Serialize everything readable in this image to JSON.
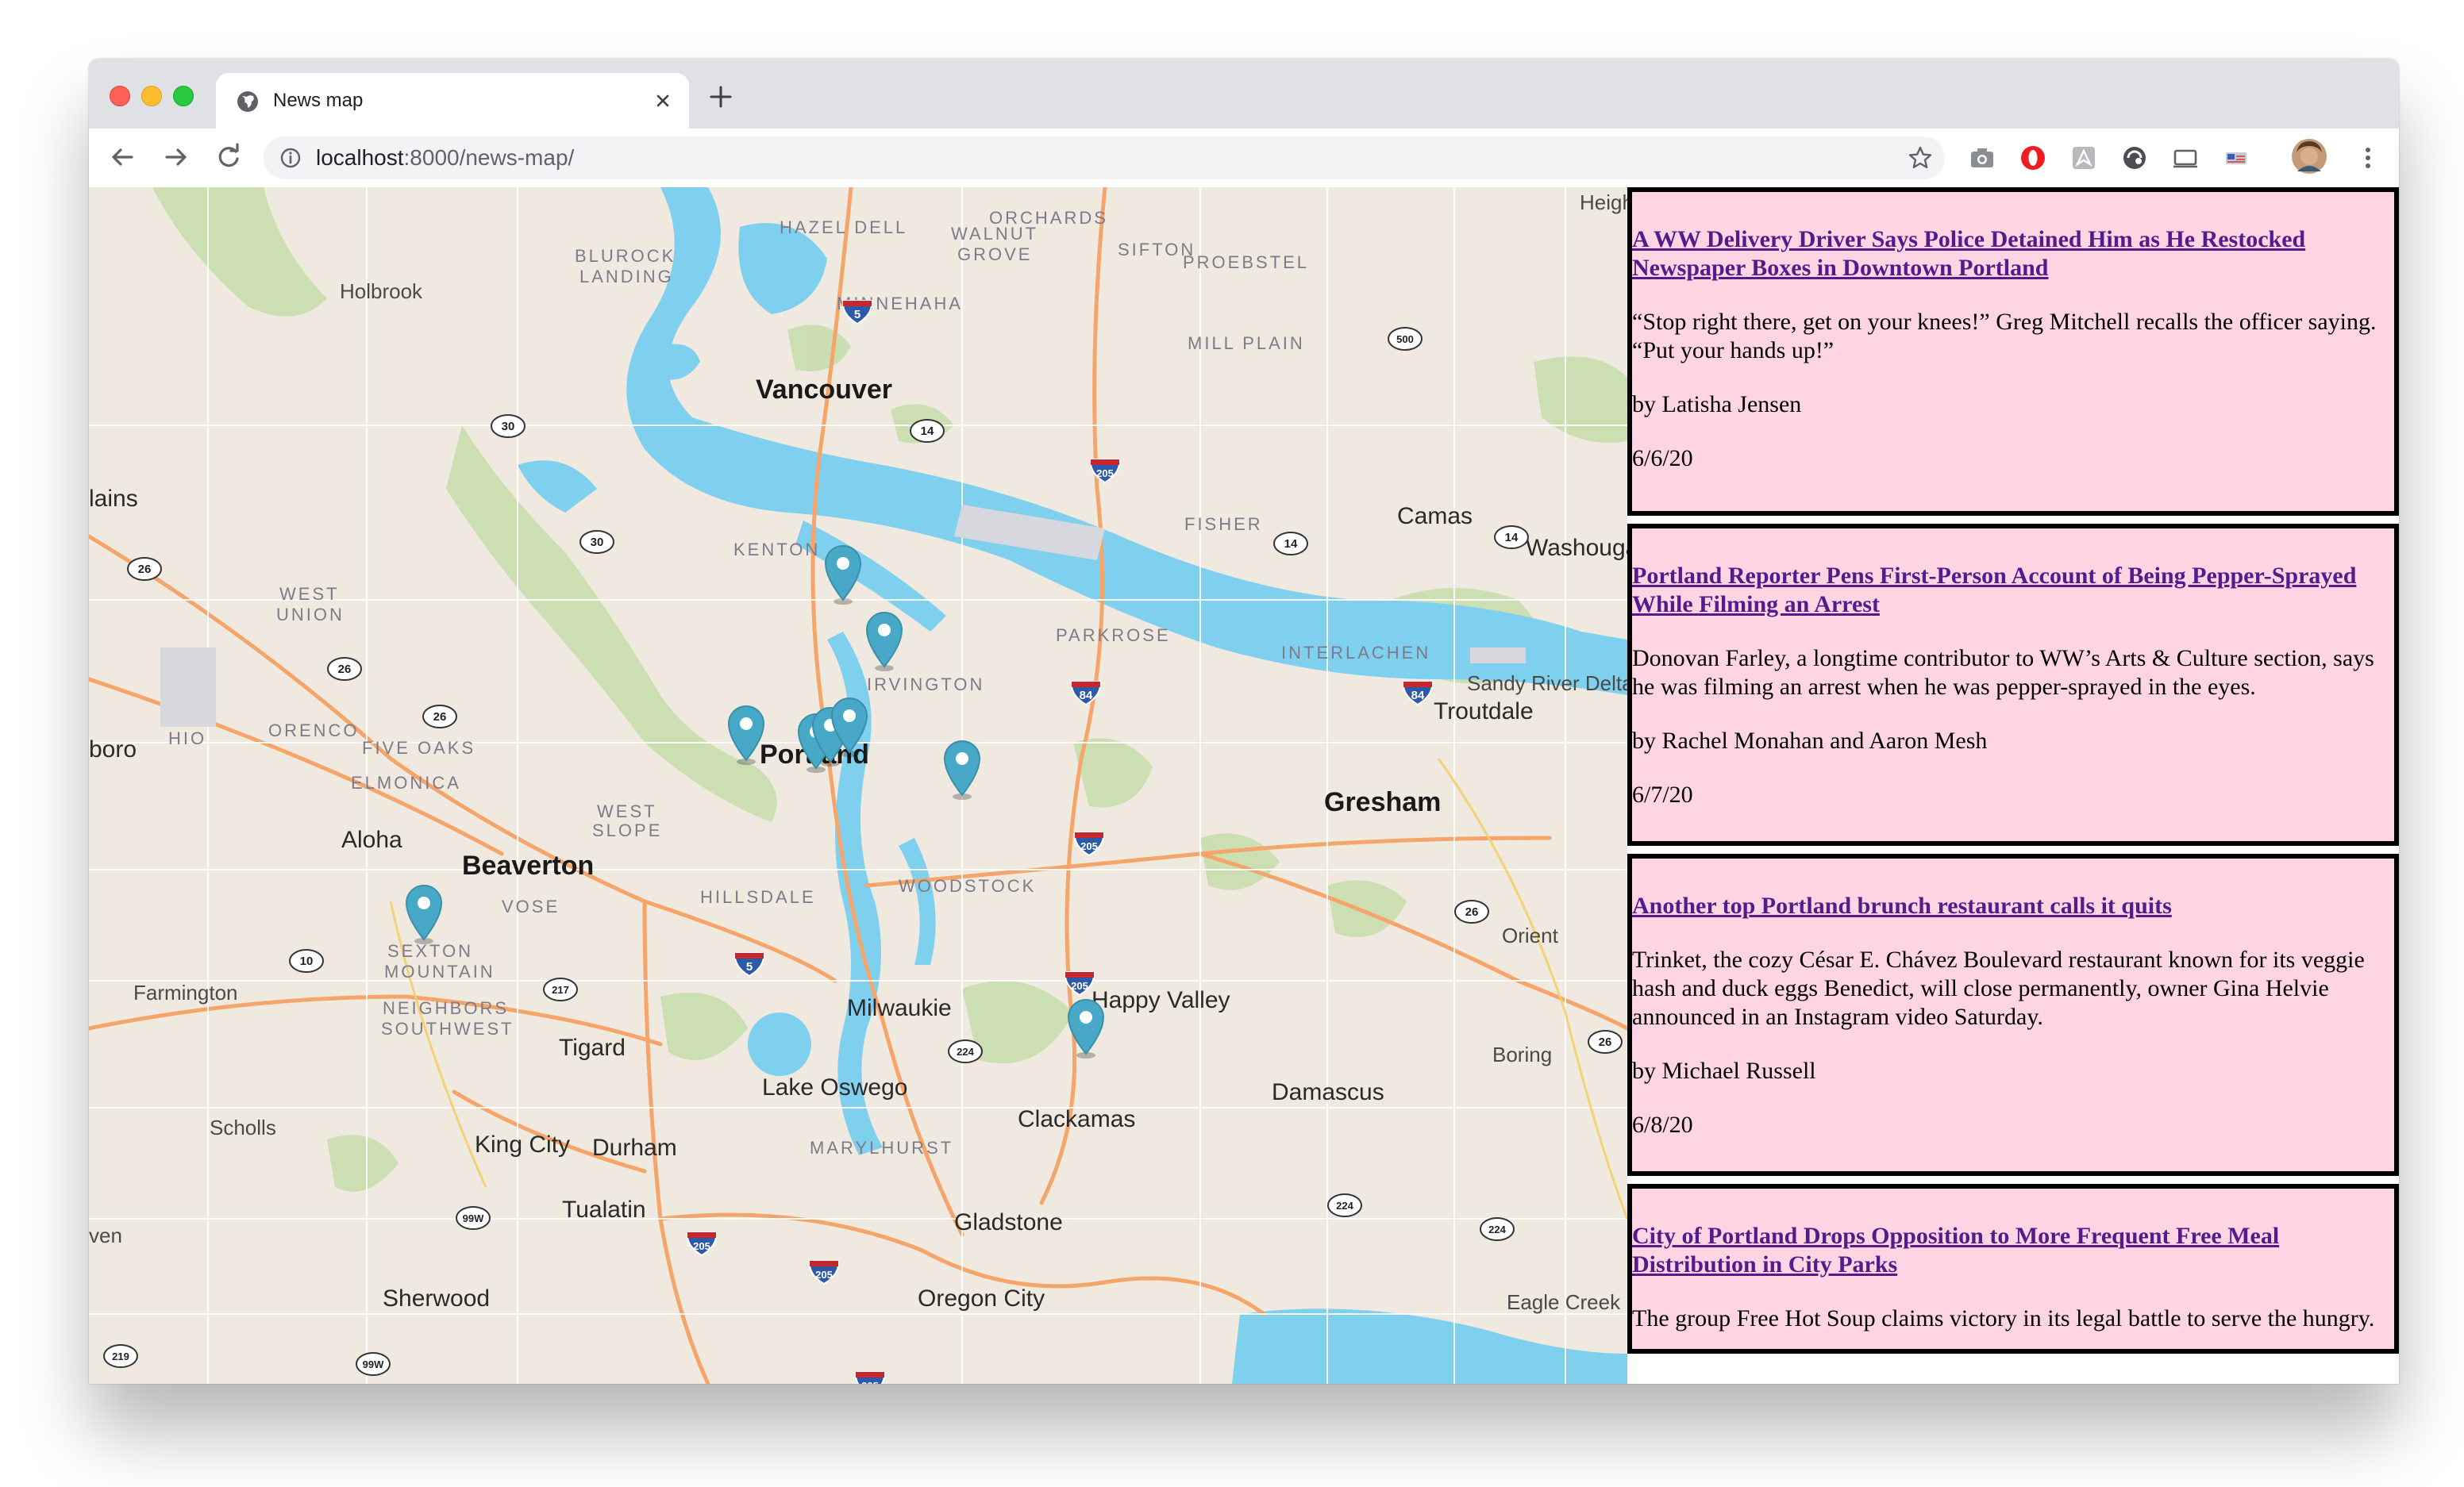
{
  "browser": {
    "tab_title": "News map",
    "url_host": "localhost",
    "url_path": ":8000/news-map/"
  },
  "map": {
    "labels": [
      {
        "text": "Vancouver",
        "kind": "big"
      },
      {
        "text": "Portland",
        "kind": "big"
      },
      {
        "text": "Gresham",
        "kind": "big"
      },
      {
        "text": "Beaverton",
        "kind": "big"
      },
      {
        "text": "Milwaukie",
        "kind": "mid"
      },
      {
        "text": "Happy Valley",
        "kind": "mid"
      },
      {
        "text": "Lake Oswego",
        "kind": "mid"
      },
      {
        "text": "Clackamas",
        "kind": "mid"
      },
      {
        "text": "Tigard",
        "kind": "mid"
      },
      {
        "text": "Aloha",
        "kind": "mid"
      },
      {
        "text": "Tualatin",
        "kind": "mid"
      },
      {
        "text": "Durham",
        "kind": "mid"
      },
      {
        "text": "King City",
        "kind": "mid"
      },
      {
        "text": "Gladstone",
        "kind": "mid"
      },
      {
        "text": "Oregon City",
        "kind": "mid"
      },
      {
        "text": "Sherwood",
        "kind": "mid"
      },
      {
        "text": "Troutdale",
        "kind": "mid"
      },
      {
        "text": "Camas",
        "kind": "mid"
      },
      {
        "text": "Washougal",
        "kind": "mid"
      },
      {
        "text": "Damascus",
        "kind": "mid"
      },
      {
        "text": "Boring",
        "kind": "small"
      },
      {
        "text": "Orient",
        "kind": "small"
      },
      {
        "text": "Eagle Creek",
        "kind": "small"
      },
      {
        "text": "Farmington",
        "kind": "small"
      },
      {
        "text": "Scholls",
        "kind": "small"
      },
      {
        "text": "Holbrook",
        "kind": "small"
      },
      {
        "text": "Sandy River Delta",
        "kind": "small"
      },
      {
        "text": "boro",
        "kind": "mid"
      },
      {
        "text": "lains",
        "kind": "mid"
      },
      {
        "text": "ven",
        "kind": "small"
      },
      {
        "text": "Heigh",
        "kind": "small"
      },
      {
        "text": "HAZEL DELL",
        "kind": "hood"
      },
      {
        "text": "ORCHARDS",
        "kind": "hood"
      },
      {
        "text": "WALNUT",
        "kind": "hood"
      },
      {
        "text": "GROVE",
        "kind": "hood"
      },
      {
        "text": "SIFTON",
        "kind": "hood"
      },
      {
        "text": "PROEBSTEL",
        "kind": "hood"
      },
      {
        "text": "BLUROCK",
        "kind": "hood"
      },
      {
        "text": "LANDING",
        "kind": "hood"
      },
      {
        "text": "MINNEHAHA",
        "kind": "hood"
      },
      {
        "text": "MILL PLAIN",
        "kind": "hood"
      },
      {
        "text": "KENTON",
        "kind": "hood"
      },
      {
        "text": "FISHER",
        "kind": "hood"
      },
      {
        "text": "PARKROSE",
        "kind": "hood"
      },
      {
        "text": "IRVINGTON",
        "kind": "hood"
      },
      {
        "text": "INTERLACHEN",
        "kind": "hood"
      },
      {
        "text": "WEST",
        "kind": "hood"
      },
      {
        "text": "UNION",
        "kind": "hood"
      },
      {
        "text": "ORENCO",
        "kind": "hood"
      },
      {
        "text": "HIO",
        "kind": "hood"
      },
      {
        "text": "FIVE OAKS",
        "kind": "hood"
      },
      {
        "text": "ELMONICA",
        "kind": "hood"
      },
      {
        "text": "WEST",
        "kind": "hood"
      },
      {
        "text": "SLOPE",
        "kind": "hood"
      },
      {
        "text": "HILLSDALE",
        "kind": "hood"
      },
      {
        "text": "WOODSTOCK",
        "kind": "hood"
      },
      {
        "text": "VOSE",
        "kind": "hood"
      },
      {
        "text": "SEXTON",
        "kind": "hood"
      },
      {
        "text": "MOUNTAIN",
        "kind": "hood"
      },
      {
        "text": "NEIGHBORS",
        "kind": "hood"
      },
      {
        "text": "SOUTHWEST",
        "kind": "hood"
      },
      {
        "text": "MARYLHURST",
        "kind": "hood"
      }
    ],
    "shields": [
      "5",
      "500",
      "14",
      "30",
      "205",
      "14",
      "14",
      "26",
      "26",
      "30",
      "26",
      "84",
      "84",
      "205",
      "26",
      "10",
      "217",
      "5",
      "205",
      "224",
      "26",
      "99W",
      "205",
      "205",
      "224",
      "224",
      "99W",
      "219",
      "205"
    ],
    "pin_count": 9,
    "pin_color": "#47a9c7"
  },
  "articles": [
    {
      "title": "A WW Delivery Driver Says Police Detained Him as He Restocked Newspaper Boxes in Downtown Portland",
      "summary": "“Stop right there, get on your knees!” Greg Mitchell recalls the officer saying. “Put your hands up!”",
      "byline": "by Latisha Jensen",
      "date": "6/6/20"
    },
    {
      "title": "Portland Reporter Pens First-Person Account of Being Pepper-Sprayed While Filming an Arrest",
      "summary": "Donovan Farley, a longtime contributor to WW’s Arts & Culture section, says he was filming an arrest when he was pepper-sprayed in the eyes.",
      "byline": "by Rachel Monahan and Aaron Mesh",
      "date": "6/7/20"
    },
    {
      "title": "Another top Portland brunch restaurant calls it quits",
      "summary": "Trinket, the cozy César E. Chávez Boulevard restaurant known for its veggie hash and duck eggs Benedict, will close permanently, owner Gina Helvie announced in an Instagram video Saturday.",
      "byline": "by Michael Russell",
      "date": "6/8/20"
    },
    {
      "title": "City of Portland Drops Opposition to More Frequent Free Meal Distribution in City Parks",
      "summary": "The group Free Hot Soup claims victory in its legal battle to serve the hungry.",
      "byline": "",
      "date": ""
    }
  ]
}
